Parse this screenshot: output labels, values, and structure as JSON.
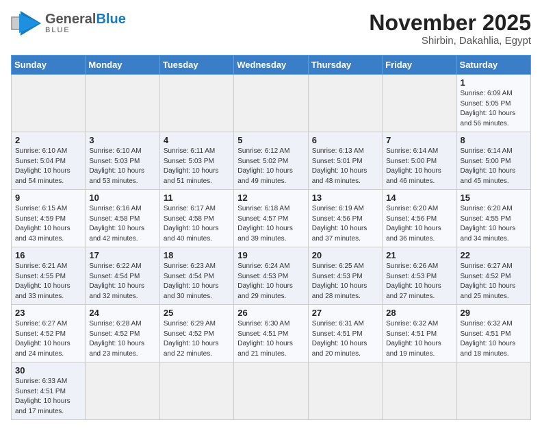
{
  "header": {
    "logo_general": "General",
    "logo_blue": "Blue",
    "title": "November 2025",
    "location": "Shirbin, Dakahlia, Egypt"
  },
  "weekdays": [
    "Sunday",
    "Monday",
    "Tuesday",
    "Wednesday",
    "Thursday",
    "Friday",
    "Saturday"
  ],
  "weeks": [
    [
      {
        "day": "",
        "info": ""
      },
      {
        "day": "",
        "info": ""
      },
      {
        "day": "",
        "info": ""
      },
      {
        "day": "",
        "info": ""
      },
      {
        "day": "",
        "info": ""
      },
      {
        "day": "",
        "info": ""
      },
      {
        "day": "1",
        "info": "Sunrise: 6:09 AM\nSunset: 5:05 PM\nDaylight: 10 hours and 56 minutes."
      }
    ],
    [
      {
        "day": "2",
        "info": "Sunrise: 6:10 AM\nSunset: 5:04 PM\nDaylight: 10 hours and 54 minutes."
      },
      {
        "day": "3",
        "info": "Sunrise: 6:10 AM\nSunset: 5:03 PM\nDaylight: 10 hours and 53 minutes."
      },
      {
        "day": "4",
        "info": "Sunrise: 6:11 AM\nSunset: 5:03 PM\nDaylight: 10 hours and 51 minutes."
      },
      {
        "day": "5",
        "info": "Sunrise: 6:12 AM\nSunset: 5:02 PM\nDaylight: 10 hours and 49 minutes."
      },
      {
        "day": "6",
        "info": "Sunrise: 6:13 AM\nSunset: 5:01 PM\nDaylight: 10 hours and 48 minutes."
      },
      {
        "day": "7",
        "info": "Sunrise: 6:14 AM\nSunset: 5:00 PM\nDaylight: 10 hours and 46 minutes."
      },
      {
        "day": "8",
        "info": "Sunrise: 6:14 AM\nSunset: 5:00 PM\nDaylight: 10 hours and 45 minutes."
      }
    ],
    [
      {
        "day": "9",
        "info": "Sunrise: 6:15 AM\nSunset: 4:59 PM\nDaylight: 10 hours and 43 minutes."
      },
      {
        "day": "10",
        "info": "Sunrise: 6:16 AM\nSunset: 4:58 PM\nDaylight: 10 hours and 42 minutes."
      },
      {
        "day": "11",
        "info": "Sunrise: 6:17 AM\nSunset: 4:58 PM\nDaylight: 10 hours and 40 minutes."
      },
      {
        "day": "12",
        "info": "Sunrise: 6:18 AM\nSunset: 4:57 PM\nDaylight: 10 hours and 39 minutes."
      },
      {
        "day": "13",
        "info": "Sunrise: 6:19 AM\nSunset: 4:56 PM\nDaylight: 10 hours and 37 minutes."
      },
      {
        "day": "14",
        "info": "Sunrise: 6:20 AM\nSunset: 4:56 PM\nDaylight: 10 hours and 36 minutes."
      },
      {
        "day": "15",
        "info": "Sunrise: 6:20 AM\nSunset: 4:55 PM\nDaylight: 10 hours and 34 minutes."
      }
    ],
    [
      {
        "day": "16",
        "info": "Sunrise: 6:21 AM\nSunset: 4:55 PM\nDaylight: 10 hours and 33 minutes."
      },
      {
        "day": "17",
        "info": "Sunrise: 6:22 AM\nSunset: 4:54 PM\nDaylight: 10 hours and 32 minutes."
      },
      {
        "day": "18",
        "info": "Sunrise: 6:23 AM\nSunset: 4:54 PM\nDaylight: 10 hours and 30 minutes."
      },
      {
        "day": "19",
        "info": "Sunrise: 6:24 AM\nSunset: 4:53 PM\nDaylight: 10 hours and 29 minutes."
      },
      {
        "day": "20",
        "info": "Sunrise: 6:25 AM\nSunset: 4:53 PM\nDaylight: 10 hours and 28 minutes."
      },
      {
        "day": "21",
        "info": "Sunrise: 6:26 AM\nSunset: 4:53 PM\nDaylight: 10 hours and 27 minutes."
      },
      {
        "day": "22",
        "info": "Sunrise: 6:27 AM\nSunset: 4:52 PM\nDaylight: 10 hours and 25 minutes."
      }
    ],
    [
      {
        "day": "23",
        "info": "Sunrise: 6:27 AM\nSunset: 4:52 PM\nDaylight: 10 hours and 24 minutes."
      },
      {
        "day": "24",
        "info": "Sunrise: 6:28 AM\nSunset: 4:52 PM\nDaylight: 10 hours and 23 minutes."
      },
      {
        "day": "25",
        "info": "Sunrise: 6:29 AM\nSunset: 4:52 PM\nDaylight: 10 hours and 22 minutes."
      },
      {
        "day": "26",
        "info": "Sunrise: 6:30 AM\nSunset: 4:51 PM\nDaylight: 10 hours and 21 minutes."
      },
      {
        "day": "27",
        "info": "Sunrise: 6:31 AM\nSunset: 4:51 PM\nDaylight: 10 hours and 20 minutes."
      },
      {
        "day": "28",
        "info": "Sunrise: 6:32 AM\nSunset: 4:51 PM\nDaylight: 10 hours and 19 minutes."
      },
      {
        "day": "29",
        "info": "Sunrise: 6:32 AM\nSunset: 4:51 PM\nDaylight: 10 hours and 18 minutes."
      }
    ],
    [
      {
        "day": "30",
        "info": "Sunrise: 6:33 AM\nSunset: 4:51 PM\nDaylight: 10 hours and 17 minutes."
      },
      {
        "day": "",
        "info": ""
      },
      {
        "day": "",
        "info": ""
      },
      {
        "day": "",
        "info": ""
      },
      {
        "day": "",
        "info": ""
      },
      {
        "day": "",
        "info": ""
      },
      {
        "day": "",
        "info": ""
      }
    ]
  ]
}
